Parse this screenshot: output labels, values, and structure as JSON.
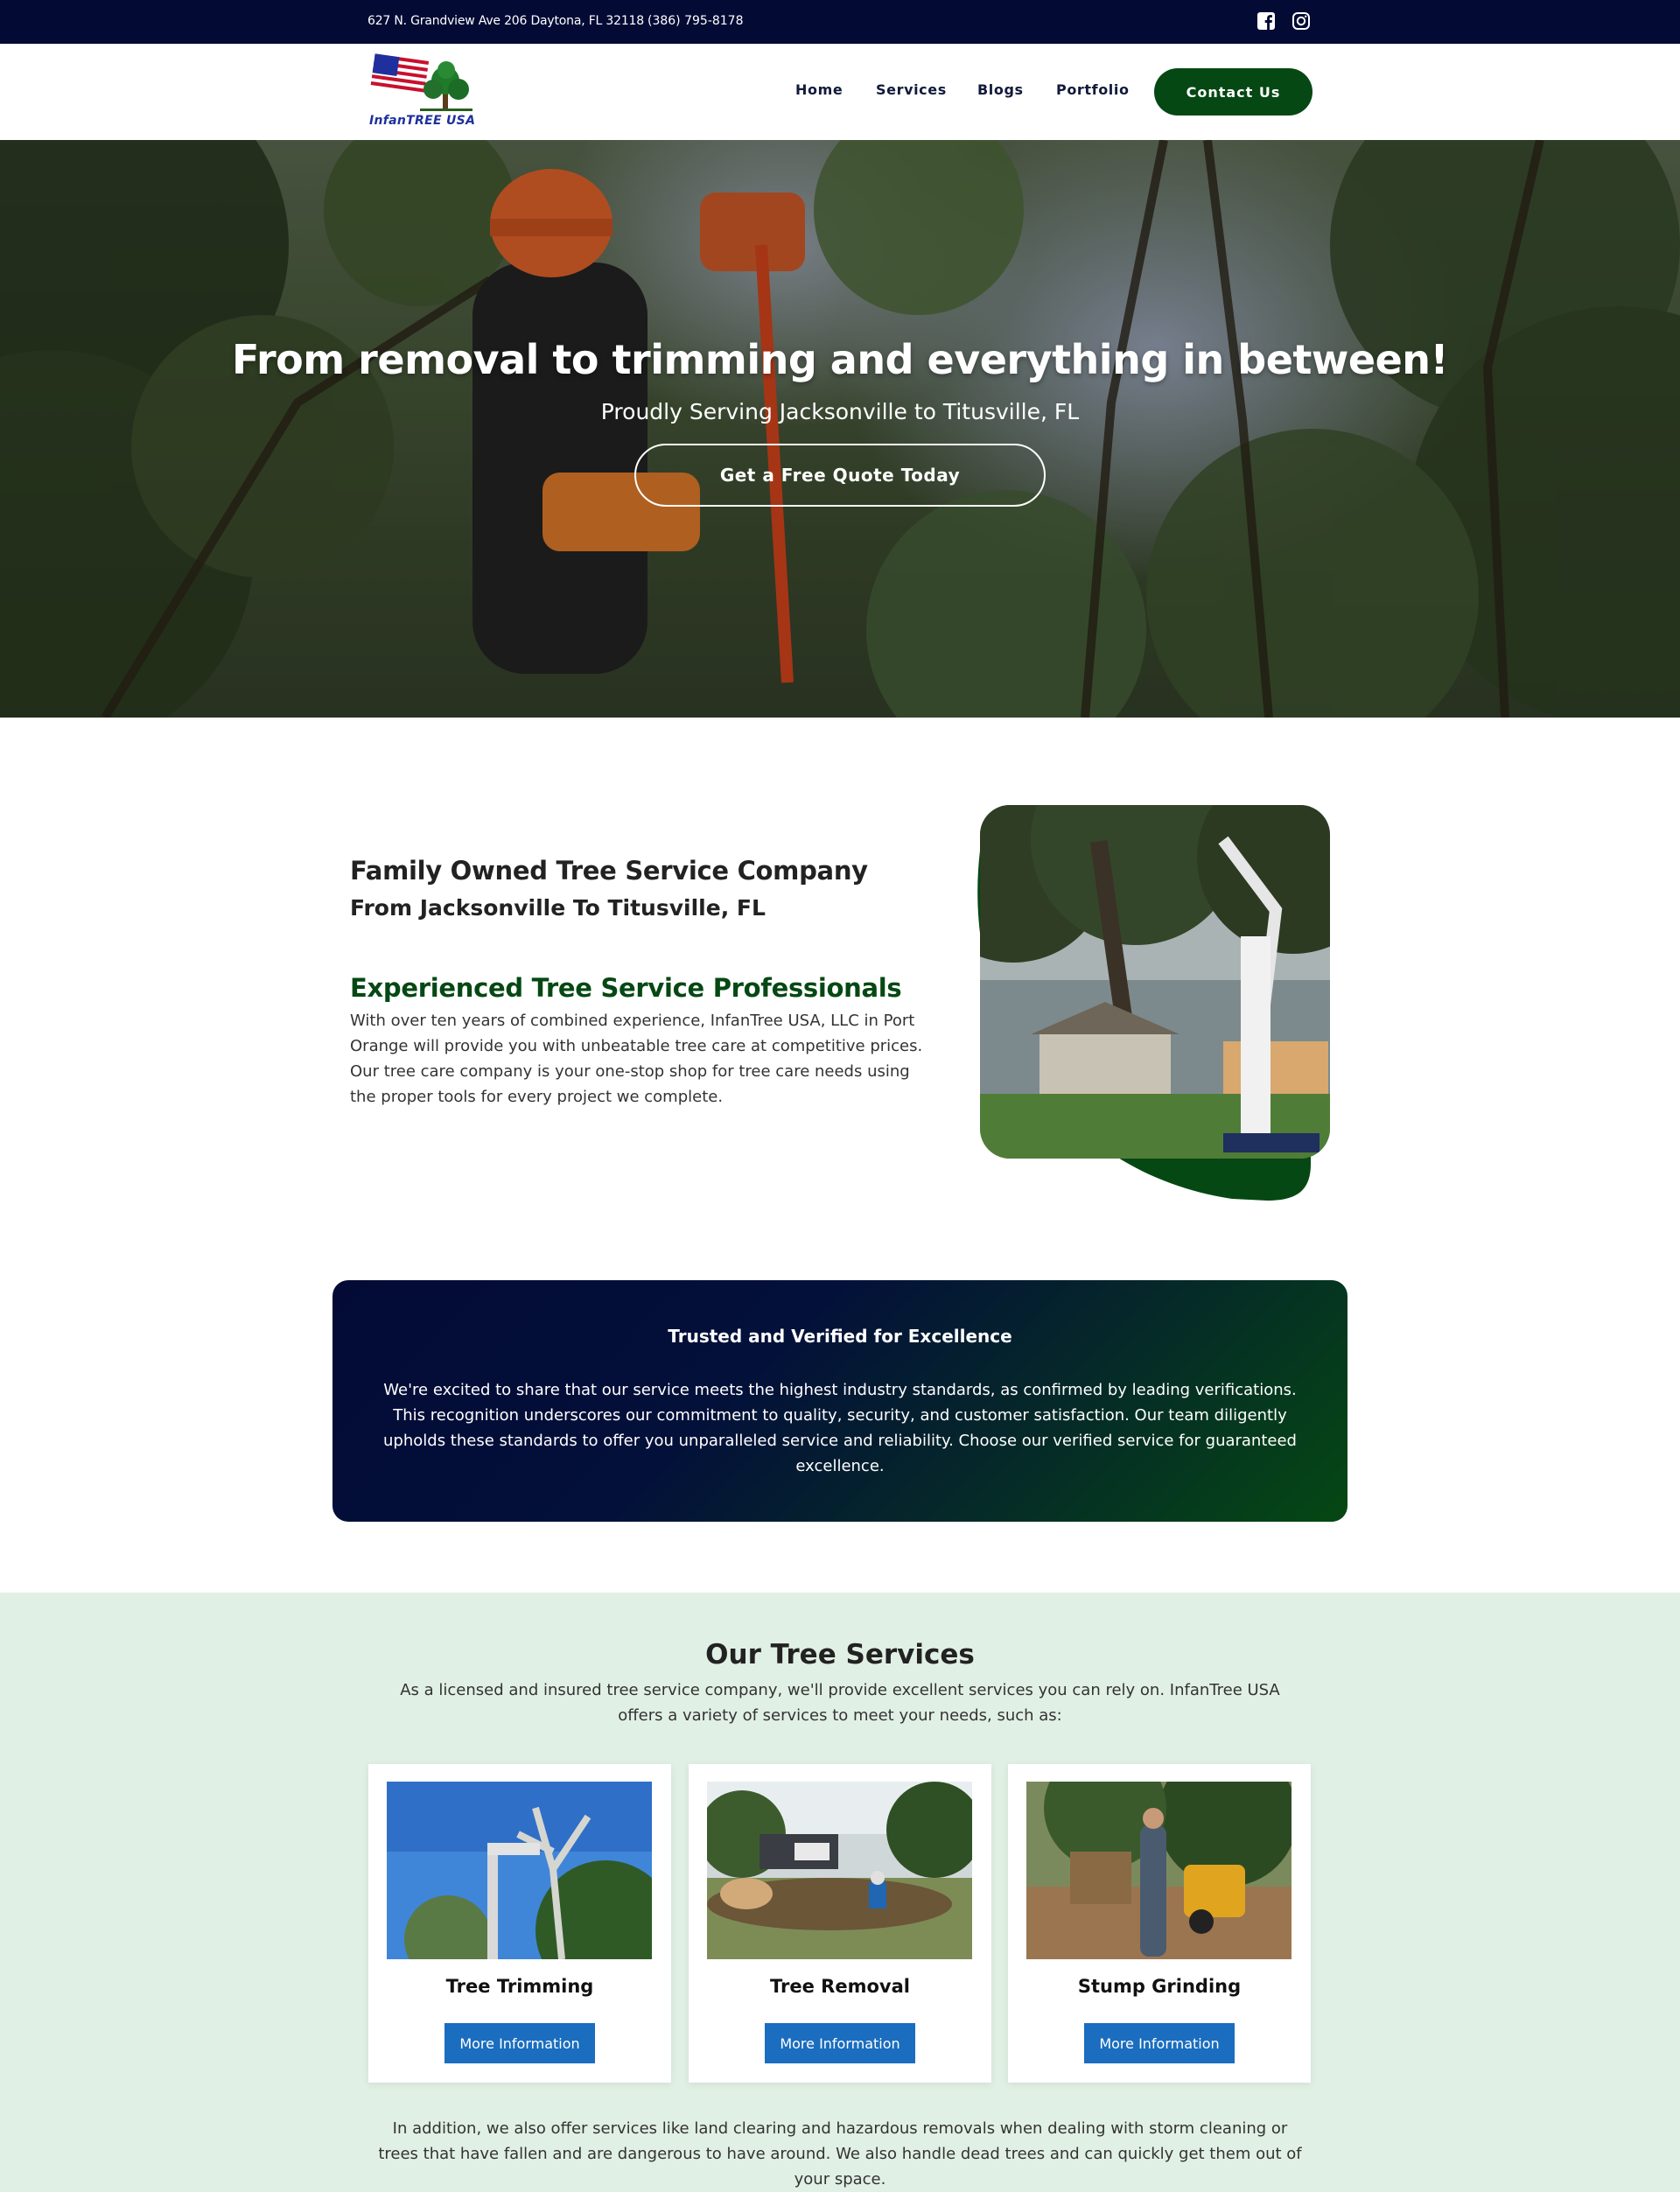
{
  "topbar": {
    "address": "627 N. Grandview Ave 206 Daytona, FL 32118",
    "phone": "(386) 795-8178",
    "social": [
      "facebook-icon",
      "instagram-icon"
    ]
  },
  "header": {
    "logo_text": "InfanTREE USA",
    "nav": [
      "Home",
      "Services",
      "Blogs",
      "Portfolio"
    ],
    "contact_label": "Contact Us"
  },
  "hero": {
    "title": "From removal to trimming and everything in between!",
    "subtitle": "Proudly Serving Jacksonville to Titusville, FL",
    "cta": "Get a Free Quote Today"
  },
  "about": {
    "heading": "Family Owned Tree Service Company",
    "subheading": "From Jacksonville To Titusville, FL",
    "section_title": "Experienced Tree Service Professionals",
    "body": "With over ten years of combined experience, InfanTree USA, LLC in Port Orange will provide you with unbeatable tree care at competitive prices. Our tree care company is your one-stop shop for tree care needs using the proper tools for every project we complete."
  },
  "trusted": {
    "title": "Trusted and Verified for Excellence",
    "body": "We're excited to share that our service meets the highest industry standards, as confirmed by leading verifications. This recognition underscores our commitment to quality, security, and customer satisfaction. Our team diligently upholds these standards to offer you unparalleled service and reliability. Choose our verified service for guaranteed excellence."
  },
  "services": {
    "title": "Our Tree Services",
    "intro": "As a licensed and insured tree service company, we'll provide excellent services you can rely on. InfanTree USA offers a variety of services to meet your needs, such as:",
    "cards": [
      {
        "title": "Tree Trimming",
        "button": "More Information"
      },
      {
        "title": "Tree Removal",
        "button": "More Information"
      },
      {
        "title": "Stump Grinding",
        "button": "More Information"
      }
    ],
    "footer": "In addition, we also offer services like land clearing and hazardous removals when dealing with storm cleaning or trees that have fallen and are dangerous to have around. We also handle dead trees and can quickly get them out of your space."
  },
  "colors": {
    "navy": "#030b35",
    "brand_green": "#054813",
    "button_blue": "#1a6dbf",
    "services_bg": "#e1f0e4"
  }
}
